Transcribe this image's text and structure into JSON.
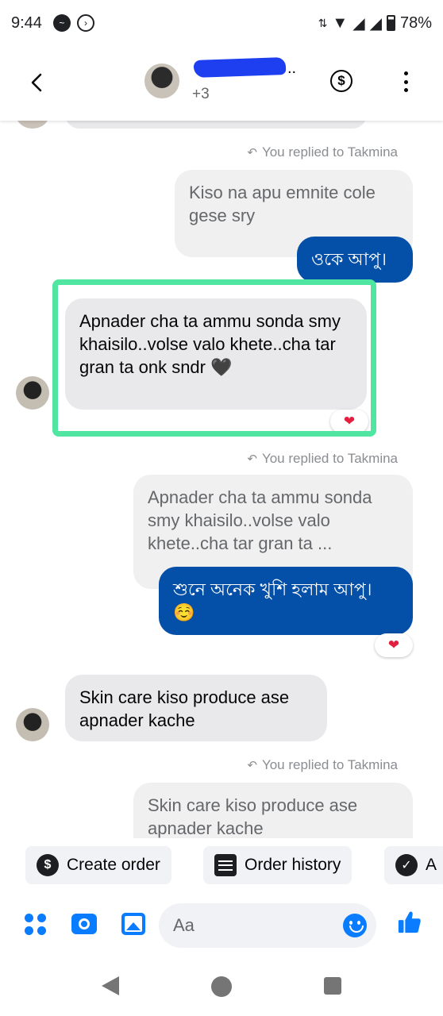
{
  "status_bar": {
    "time": "9:44",
    "battery": "78%"
  },
  "header": {
    "back_icon": "chevron-left-icon",
    "participants_more": "+3",
    "name_dots": "..",
    "pay_icon": "dollar-circle-icon",
    "menu_icon": "vertical-dots-icon"
  },
  "messages": [
    {
      "reply_label": "You replied to Takmina",
      "quoted": "Kiso na apu emnite cole gese sry",
      "outgoing": "ওকে আপু।"
    },
    {
      "incoming": "Apnader cha ta ammu sonda smy khaisilo..volse valo khete..cha tar gran ta onk sndr 🖤",
      "reaction": "❤"
    },
    {
      "reply_label": "You replied to Takmina",
      "quoted": "Apnader cha ta ammu sonda smy khaisilo..volse valo khete..cha tar gran ta ...",
      "outgoing": "শুনে অনেক খুশি হলাম আপু। ☺️",
      "reaction": "❤"
    },
    {
      "incoming": "Skin care kiso produce ase apnader kache"
    },
    {
      "reply_label": "You replied to Takmina",
      "quoted": "Skin care kiso produce ase apnader kache"
    }
  ],
  "quick_actions": [
    {
      "label": "Create order",
      "icon": "dollar-circle-icon"
    },
    {
      "label": "Order history",
      "icon": "list-icon"
    },
    {
      "label": "A",
      "icon": "check-circle-icon"
    }
  ],
  "composer": {
    "placeholder": "Aa"
  },
  "colors": {
    "accent": "#0a7cff",
    "outgoing_bubble": "#0450a8",
    "incoming_bubble": "#e9e9eb",
    "highlight": "#50e6a2",
    "reaction_heart": "#e41e3f"
  }
}
